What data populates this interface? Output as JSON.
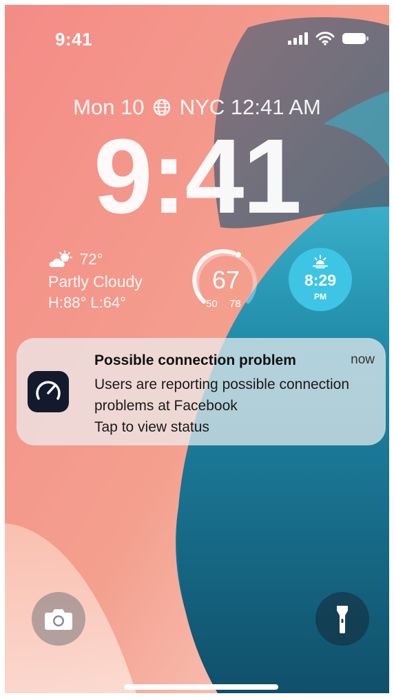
{
  "status_bar": {
    "time": "9:41",
    "icons": [
      "cellular-signal-icon",
      "wifi-icon",
      "battery-icon"
    ]
  },
  "lock_screen": {
    "date_prefix": "Mon 10",
    "world_clock": "NYC 12:41 AM",
    "clock": "9:41"
  },
  "widgets": {
    "weather": {
      "icon": "partly-cloudy-icon",
      "temperature": "72°",
      "condition": "Partly Cloudy",
      "high_low": "H:88° L:64°"
    },
    "temperature_gauge": {
      "value": "67",
      "low": "50",
      "high": "78",
      "level": 0.6
    },
    "sunset": {
      "icon": "sunset-icon",
      "time": "8:29",
      "period": "PM"
    }
  },
  "notification": {
    "app_icon": "speedometer-icon",
    "title": "Possible connection problem",
    "time": "now",
    "line1": "Users are reporting possible connection",
    "line2": "problems at Facebook",
    "line3": "Tap to view status"
  },
  "quick_actions": {
    "left": "camera-icon",
    "right": "flashlight-icon"
  },
  "colors": {
    "wallpaper_pink": "#f2968c",
    "wallpaper_peach": "#fbd6cb",
    "wallpaper_teal": "#137391",
    "wallpaper_cyan": "#47bcd6",
    "wallpaper_slate": "#566a7c",
    "sunset_widget": "#3ec5e6",
    "app_icon_bg": "#141a2e"
  }
}
